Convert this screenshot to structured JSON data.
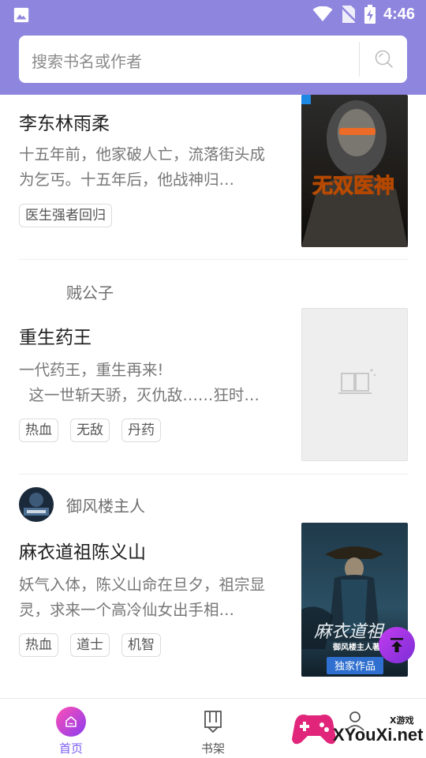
{
  "status_bar": {
    "time": "4:46"
  },
  "search": {
    "placeholder": "搜索书名或作者"
  },
  "books": [
    {
      "title": "李东林雨柔",
      "description": "十五年前，他家破人亡，流落街头成为乞丐。十五年后，他战神归…",
      "tags": [
        "医生强者回归"
      ],
      "cover_text": "无双医神"
    },
    {
      "author": "贼公子",
      "title": "重生药王",
      "description": "一代药王，重生再来!\n  这一世斩天骄，灭仇敌……狂时…",
      "tags": [
        "热血",
        "无敌",
        "丹药"
      ]
    },
    {
      "author": "御风楼主人",
      "title": "麻衣道祖陈义山",
      "description": "妖气入体，陈义山命在旦夕，祖宗显灵，求来一个高冷仙女出手相…",
      "tags": [
        "热血",
        "道士",
        "机智"
      ],
      "cover_text": "麻衣道祖",
      "cover_author": "御风楼主人著",
      "cover_badge": "独家作品"
    }
  ],
  "bottom_nav": [
    {
      "label": "首页",
      "icon": "home-icon",
      "active": true
    },
    {
      "label": "书架",
      "icon": "bookshelf-icon",
      "active": false
    }
  ],
  "watermark": {
    "text": "XYouXi.net",
    "small_text": "X游戏"
  },
  "colors": {
    "header": "#8e86de",
    "accent": "#8a3cf0",
    "nav_active": "#7b5cf0"
  }
}
